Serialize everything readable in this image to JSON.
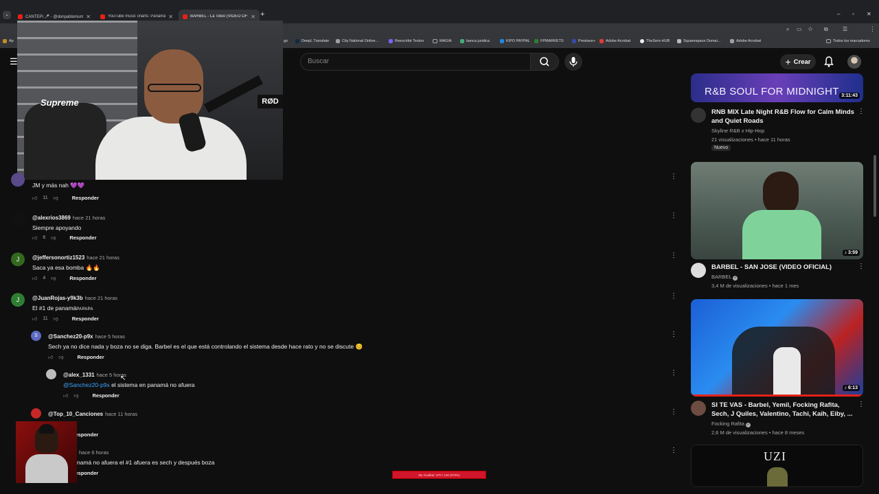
{
  "tabs": [
    {
      "label": "CANTEPI 🎤 - @donpablomum"
    },
    {
      "label": "YouTube music charts: Panamá"
    },
    {
      "label": "BARBEL - La Tokio (VIDEO OFIC"
    }
  ],
  "bookmarks": [
    "DeepL Translate",
    "City National Online...",
    "Reescribir Textos",
    "MAGIA",
    "banca juridica",
    "KIPO PAYPAL",
    "FPMARKETS",
    "Prestave+",
    "Adobe Acrobat",
    "TheSers-HUB",
    "Squarespace Domai...",
    "Adobe Acrobat",
    "Todos los marcadores"
  ],
  "header": {
    "search_placeholder": "Buscar",
    "create_label": "Crear"
  },
  "webcam": {
    "shirt_logo": "Supreme",
    "mic_brand": "RØD"
  },
  "comments": [
    {
      "text": "JM y más nah 💜💜",
      "likes": "11",
      "reply": "Responder"
    },
    {
      "handle": "@alexrios3869",
      "time": "hace 21 horas",
      "text": "Siempre apoyando",
      "likes": "6",
      "reply": "Responder"
    },
    {
      "avatar_letter": "J",
      "handle": "@jeffersonortiz1523",
      "time": "hace 21 horas",
      "text": "Saca ya esa bomba 🔥🔥",
      "likes": "4",
      "reply": "Responder"
    },
    {
      "avatar_letter": "J",
      "handle": "@JuanRojas-y9k3b",
      "time": "hace 21 horas",
      "text": "El #1 de panamá",
      "text_suffix": "PAPAPA",
      "likes": "11",
      "reply": "Responder"
    },
    {
      "avatar_letter": "S",
      "handle": "@Sanchez20-p9x",
      "time": "hace 5 horas",
      "text": "Sech ya no dice nada y boza no se diga. Barbel es el que está controlando el sistema desde hace rato y no se discute 😊",
      "reply": "Responder"
    },
    {
      "handle": "@alex_1331",
      "time": "hace 5 horas",
      "mention": "@Sanchez20-p9x",
      "text": " el sistema en panamá no afuera",
      "reply": "Responder"
    },
    {
      "handle": "@Top_10_Canciones",
      "time": "hace 11 horas",
      "reply": "Responder"
    },
    {
      "time": "hace 6 horas",
      "text": "namá no afuera el #1 afuera es sech y después boza",
      "reply": "Responder"
    }
  ],
  "sidebar": [
    {
      "thumb_text": "R&B SOUL FOR MIDNIGHT",
      "duration": "3:11:43",
      "title": "RNB MIX Late Night R&B Flow for Calm Minds and Quiet Roads",
      "channel": "Skyline R&B x Hip-Hop",
      "meta": "21 visualizaciones • hace 11 horas",
      "badge": "Nuevo"
    },
    {
      "duration": "3:59",
      "title": "BARBEL - SAN JOSE (VIDEO OFICIAL)",
      "channel": "BARBEL",
      "meta": "3,4 M de visualizaciones • hace 1 mes"
    },
    {
      "duration": "6:13",
      "title": "SI TE VAS - Barbel, Yemil, Focking Rafita, Sech, J Quiles, Valentino, Tachi, Kaih, Eiby, ...",
      "channel": "Focking Rafita",
      "meta": "2,6 M de visualizaciones • hace 8 meses"
    },
    {
      "thumb_text": "UZI"
    }
  ],
  "overlay": {
    "progress_text": "My Goalbar: 670 / 100 (670%)"
  },
  "colors": {
    "accent": "#e62117",
    "link": "#3ea6ff",
    "background": "#0f0f0f"
  }
}
